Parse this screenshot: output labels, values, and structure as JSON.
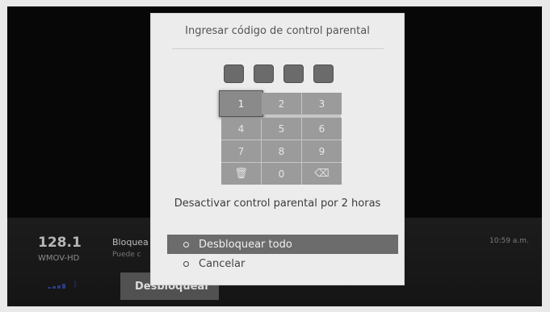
{
  "background": {
    "channel_number": "128.1",
    "channel_name": "WMOV-HD",
    "program_title": "Bloquea",
    "program_subtitle": "Puede c",
    "clock": "10:59 a.m.",
    "unlock_button_label": "Desbloquear"
  },
  "dialog": {
    "title": "Ingresar código de control parental",
    "keypad": [
      "1",
      "2",
      "3",
      "4",
      "5",
      "6",
      "7",
      "8",
      "9",
      "",
      "0",
      ""
    ],
    "disable_label": "Desactivar control parental por 2 horas",
    "options": [
      "Desbloquear todo",
      "Cancelar"
    ]
  },
  "colors": {
    "dialog_bg": "#ececec",
    "selected_option_bg": "#6c6c6c",
    "key_bg": "#9b9b9b",
    "pin_box": "#6b6b6b"
  }
}
